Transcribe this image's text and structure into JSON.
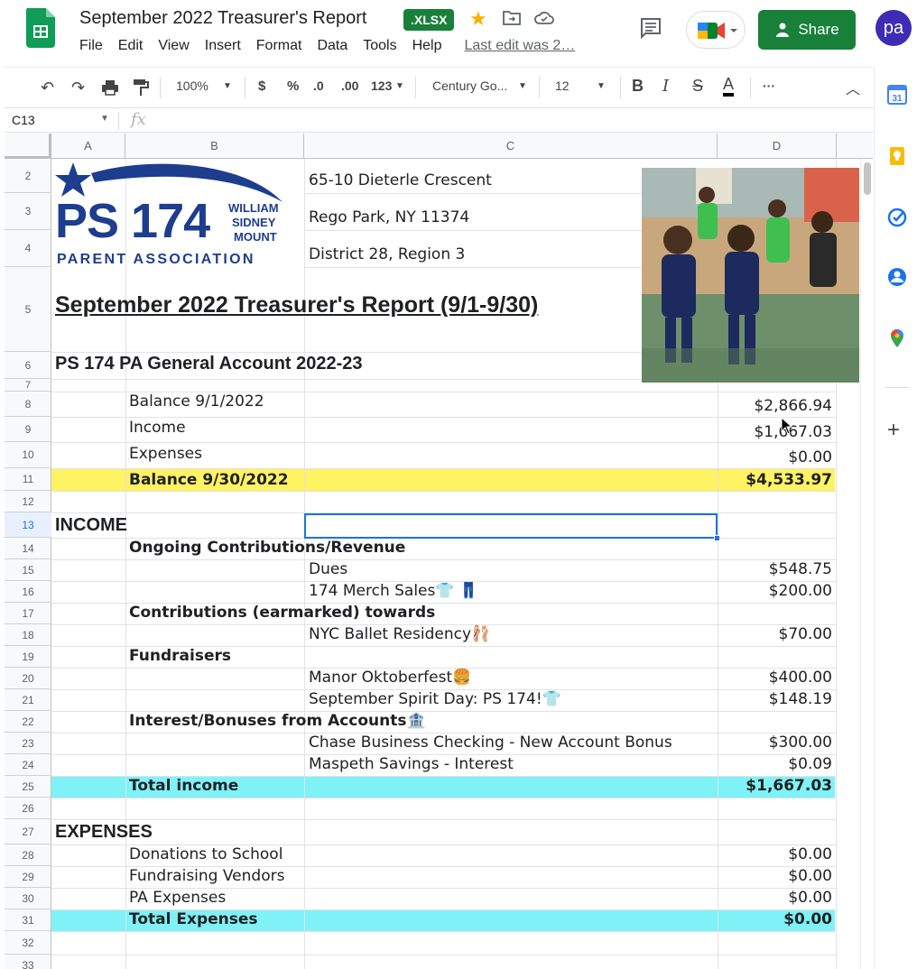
{
  "window": {
    "title": "September 2022 Treasurer's Report",
    "file_badge": ".XLSX",
    "last_edit": "Last edit was 2…",
    "share_label": "Share",
    "avatar_initials": "pa"
  },
  "menu": [
    "File",
    "Edit",
    "View",
    "Insert",
    "Format",
    "Data",
    "Tools",
    "Help"
  ],
  "toolbar": {
    "zoom": "100%",
    "currency": "$",
    "percent": "%",
    "decrease_decimal": ".0",
    "increase_decimal": ".00",
    "format_more": "123",
    "font": "Century Go...",
    "font_size": "12",
    "bold": "B",
    "italic": "I",
    "strike": "S",
    "text_color": "A",
    "more": "···"
  },
  "formula_bar": {
    "cell_ref": "C13",
    "fx": "fx",
    "value": ""
  },
  "columns": [
    "A",
    "B",
    "C",
    "D"
  ],
  "row_numbers": [
    "2",
    "3",
    "4",
    "5",
    "6",
    "7",
    "8",
    "9",
    "10",
    "11",
    "12",
    "13",
    "14",
    "15",
    "16",
    "17",
    "18",
    "19",
    "20",
    "21",
    "22",
    "23",
    "24",
    "25",
    "26",
    "27",
    "28",
    "29",
    "30",
    "31",
    "32",
    "33"
  ],
  "logo": {
    "school": "PS 174",
    "name_line1": "WILLIAM",
    "name_line2": "SIDNEY",
    "name_line3": "MOUNT",
    "association": "PARENT ASSOCIATION"
  },
  "address": {
    "line1": "65-10 Dieterle Crescent",
    "line2": "Rego Park, NY 11374",
    "line3": "District 28, Region 3"
  },
  "sheet": {
    "report_title": "September 2022 Treasurer's Report (9/1-9/30)",
    "account_title": "PS 174 PA General Account 2022-23",
    "balance_rows": [
      {
        "label": "Balance 9/1/2022",
        "amount": "$2,866.94"
      },
      {
        "label": "Income",
        "amount": "$1,667.03"
      },
      {
        "label": "Expenses",
        "amount": "$0.00"
      },
      {
        "label": "Balance 9/30/2022",
        "amount": "$4,533.97"
      }
    ],
    "income_header": "INCOME",
    "income_sections": {
      "ongoing": "Ongoing Contributions/Revenue",
      "dues": {
        "label": "Dues",
        "amount": "$548.75"
      },
      "merch": {
        "label": "174 Merch Sales👕 👖",
        "amount": "$200.00"
      },
      "earmarked": "Contributions (earmarked) towards",
      "ballet": {
        "label": "NYC Ballet Residency🩰",
        "amount": "$70.00"
      },
      "fundraisers": "Fundraisers",
      "oktoberfest": {
        "label": "Manor Oktoberfest🍔",
        "amount": "$400.00"
      },
      "spirit": {
        "label": "September Spirit Day: PS 174!👕",
        "amount": "$148.19"
      },
      "interest": "Interest/Bonuses from Accounts🏦",
      "chase": {
        "label": "Chase Business Checking - New Account Bonus",
        "amount": "$300.00"
      },
      "maspeth": {
        "label": "Maspeth Savings - Interest",
        "amount": "$0.09"
      },
      "total": {
        "label": "Total income",
        "amount": "$1,667.03"
      }
    },
    "expenses_header": "EXPENSES",
    "expenses": [
      {
        "label": "Donations to School",
        "amount": "$0.00"
      },
      {
        "label": "Fundraising Vendors",
        "amount": "$0.00"
      },
      {
        "label": "PA Expenses",
        "amount": "$0.00"
      }
    ],
    "expenses_total": {
      "label": "Total Expenses",
      "amount": "$0.00"
    }
  },
  "colors": {
    "balance_highlight": "#fff263",
    "total_highlight": "#7ff2f7",
    "logo_blue": "#1d3d8f",
    "share_green": "#188038"
  },
  "icons": {
    "side_panel": [
      "calendar-icon",
      "keep-icon",
      "tasks-icon",
      "contacts-icon",
      "maps-icon",
      "add-icon"
    ]
  }
}
